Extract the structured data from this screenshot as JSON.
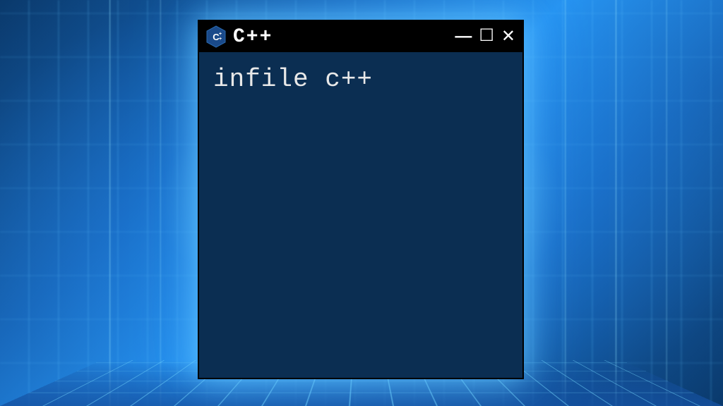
{
  "background": {
    "theme": "blue-circuit-tech"
  },
  "window": {
    "icon_name": "cpp-hex-icon",
    "title": "C++",
    "controls": {
      "minimize": "minimize",
      "maximize": "maximize",
      "close": "close"
    },
    "body_text": "infile c++",
    "body_bg": "#0b2e52",
    "text_color": "#e8e8e8"
  }
}
